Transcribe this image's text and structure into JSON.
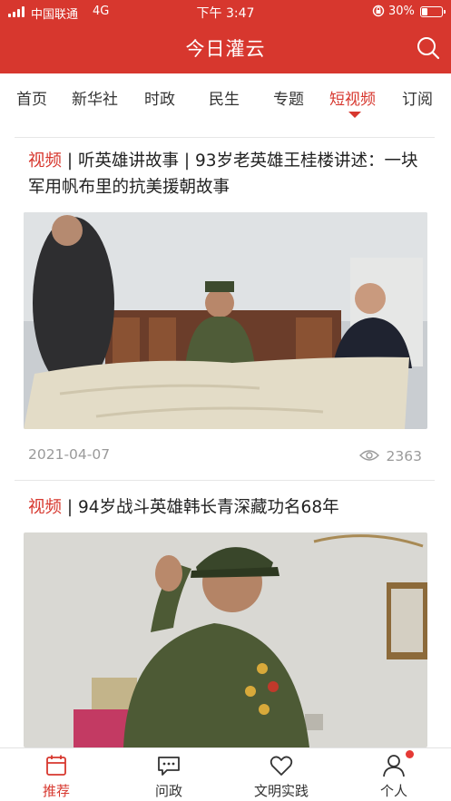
{
  "status_bar": {
    "carrier": "中国联通",
    "network": "4G",
    "time": "下午 3:47",
    "battery_text": "30%",
    "battery_level": 0.3
  },
  "header": {
    "title": "今日灌云"
  },
  "tabs": [
    {
      "label": "首页"
    },
    {
      "label": "新华社"
    },
    {
      "label": "时政"
    },
    {
      "label": "民生"
    },
    {
      "label": "专题"
    },
    {
      "label": "短视频",
      "active": true
    },
    {
      "label": "订阅"
    }
  ],
  "articles": [
    {
      "tag": "视频",
      "title": " | 听英雄讲故事 | 93岁老英雄王桂楼讲述：一块军用帆布里的抗美援朝故事",
      "date": "2021-04-07",
      "views": "2363"
    },
    {
      "tag": "视频",
      "title": " | 94岁战斗英雄韩长青深藏功名68年"
    }
  ],
  "bottom_nav": [
    {
      "label": "推荐",
      "icon": "calendar-icon",
      "active": true
    },
    {
      "label": "问政",
      "icon": "chat-icon"
    },
    {
      "label": "文明实践",
      "icon": "heart-icon"
    },
    {
      "label": "个人",
      "icon": "person-icon",
      "badge": true
    }
  ],
  "colors": {
    "brand": "#d7372e",
    "muted": "#9a9a9a"
  }
}
